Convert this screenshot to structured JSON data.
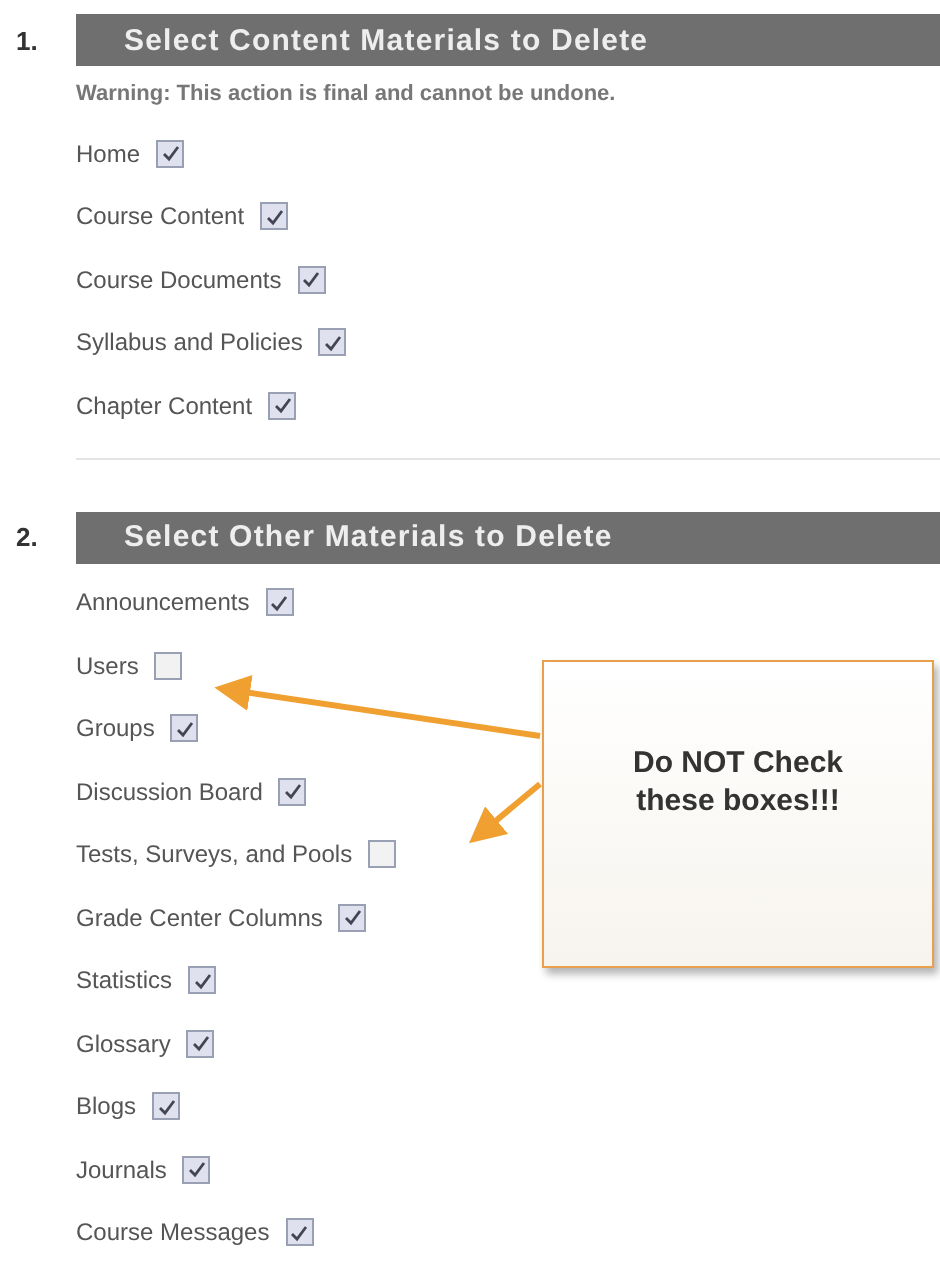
{
  "sections": [
    {
      "number": "1.",
      "title": "Select Content Materials to Delete",
      "warning": "Warning: This action is final and cannot be undone.",
      "items": [
        {
          "label": "Home",
          "checked": true
        },
        {
          "label": "Course Content",
          "checked": true
        },
        {
          "label": "Course Documents",
          "checked": true
        },
        {
          "label": "Syllabus and Policies",
          "checked": true
        },
        {
          "label": "Chapter Content",
          "checked": true
        }
      ]
    },
    {
      "number": "2.",
      "title": "Select Other Materials to Delete",
      "items": [
        {
          "label": "Announcements",
          "checked": true
        },
        {
          "label": "Users",
          "checked": false
        },
        {
          "label": "Groups",
          "checked": true
        },
        {
          "label": "Discussion Board",
          "checked": true
        },
        {
          "label": "Tests, Surveys, and Pools",
          "checked": false
        },
        {
          "label": "Grade Center Columns",
          "checked": true
        },
        {
          "label": "Statistics",
          "checked": true
        },
        {
          "label": "Glossary",
          "checked": true
        },
        {
          "label": "Blogs",
          "checked": true
        },
        {
          "label": "Journals",
          "checked": true
        },
        {
          "label": "Course Messages",
          "checked": true
        }
      ]
    }
  ],
  "callout": {
    "text": "Do NOT Check these boxes!!!"
  }
}
